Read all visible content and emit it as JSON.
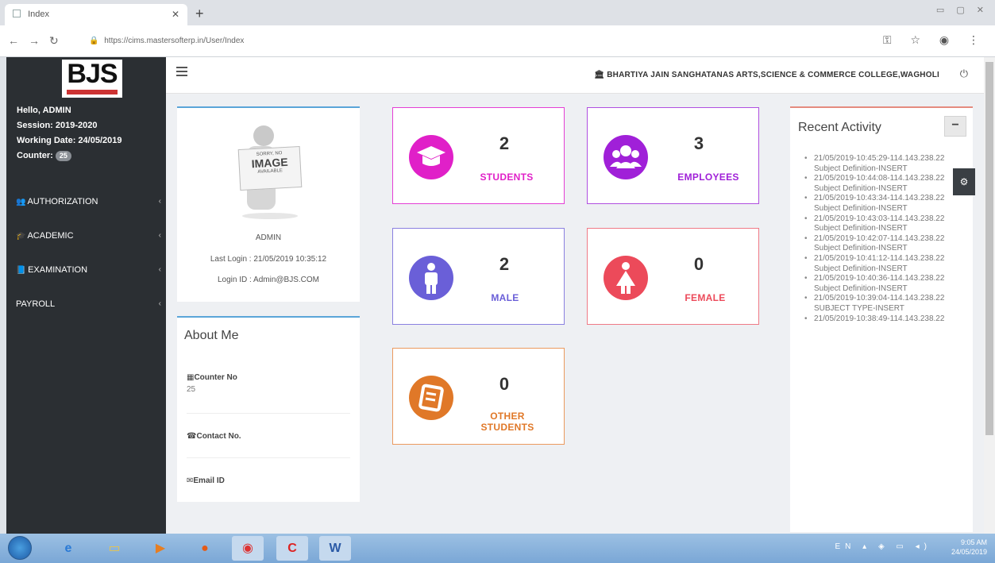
{
  "browser": {
    "tab_title": "Index",
    "url": "https://cims.mastersofterp.in/User/Index"
  },
  "sidebar": {
    "logo_text": "BJS",
    "greeting": "Hello, ADMIN",
    "session": "Session: 2019-2020",
    "working_date": "Working Date: 24/05/2019",
    "counter_label": "Counter:",
    "counter_value": "25",
    "items": [
      {
        "label": "AUTHORIZATION",
        "icon": "users-icon"
      },
      {
        "label": "ACADEMIC",
        "icon": "graduation-cap-icon"
      },
      {
        "label": "EXAMINATION",
        "icon": "book-icon"
      },
      {
        "label": "PAYROLL",
        "icon": ""
      }
    ]
  },
  "header": {
    "college": "BHARTIYA JAIN SANGHATANAS ARTS,SCIENCE & COMMERCE COLLEGE,WAGHOLI"
  },
  "profile": {
    "image_line1": "SORRY, NO",
    "image_line2": "IMAGE",
    "image_line3": "AVAILABLE",
    "name": "ADMIN",
    "last_login": "Last Login : 21/05/2019 10:35:12",
    "login_id": "Login ID : Admin@BJS.COM"
  },
  "about": {
    "title": "About Me",
    "counter_label": "Counter No",
    "counter_value": "25",
    "contact_label": "Contact No.",
    "email_label": "Email ID"
  },
  "stats": {
    "students": {
      "count": "2",
      "label": "STUDENTS",
      "color": "#e020c8"
    },
    "employees": {
      "count": "3",
      "label": "EMPLOYEES",
      "color": "#a020d8"
    },
    "male": {
      "count": "2",
      "label": "MALE",
      "color": "#6a5fd8"
    },
    "female": {
      "count": "0",
      "label": "FEMALE",
      "color": "#ec4a5a"
    },
    "other": {
      "count": "0",
      "label_1": "OTHER",
      "label_2": "STUDENTS",
      "color": "#e07828"
    }
  },
  "activity": {
    "title": "Recent Activity",
    "items": [
      "21/05/2019-10:45:29-114.143.238.22 Subject Definition-INSERT",
      "21/05/2019-10:44:08-114.143.238.22 Subject Definition-INSERT",
      "21/05/2019-10:43:34-114.143.238.22 Subject Definition-INSERT",
      "21/05/2019-10:43:03-114.143.238.22 Subject Definition-INSERT",
      "21/05/2019-10:42:07-114.143.238.22 Subject Definition-INSERT",
      "21/05/2019-10:41:12-114.143.238.22 Subject Definition-INSERT",
      "21/05/2019-10:40:36-114.143.238.22 Subject Definition-INSERT",
      "21/05/2019-10:39:04-114.143.238.22 SUBJECT TYPE-INSERT",
      "21/05/2019-10:38:49-114.143.238.22"
    ]
  },
  "taskbar": {
    "lang": "EN",
    "time": "9:05 AM",
    "date": "24/05/2019"
  }
}
